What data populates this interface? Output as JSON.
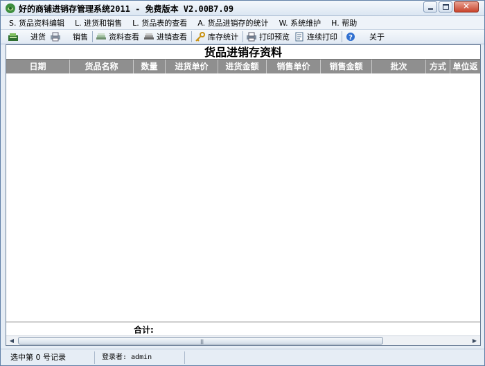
{
  "window": {
    "title": "好的商铺进销存管理系统2011 - 免费版本 V2.00B7.09"
  },
  "menu": [
    {
      "label": "S. 货品资料编辑"
    },
    {
      "label": "L. 进货和销售"
    },
    {
      "label": "L. 货品表的查看"
    },
    {
      "label": "A. 货品进销存的统计"
    },
    {
      "label": "W. 系统维护"
    },
    {
      "label": "H. 帮助"
    }
  ],
  "toolbar": {
    "purchase_label": "进货",
    "sales_label": "销售",
    "data_view_label": "资料查看",
    "purchase_sales_view_label": "进销查看",
    "stock_stats_label": "库存统计",
    "print_preview_label": "打印预览",
    "continuous_print_label": "连续打印",
    "about_label": "关于"
  },
  "grid": {
    "title": "货品进销存资料",
    "columns": [
      "日期",
      "货品名称",
      "数量",
      "进货单价",
      "进货金额",
      "销售单价",
      "销售金额",
      "批次",
      "方式",
      "单位返"
    ],
    "total_label": "合计:"
  },
  "status": {
    "selected": "选中第 0 号记录",
    "login": "登录者: admin",
    "extra": ""
  }
}
